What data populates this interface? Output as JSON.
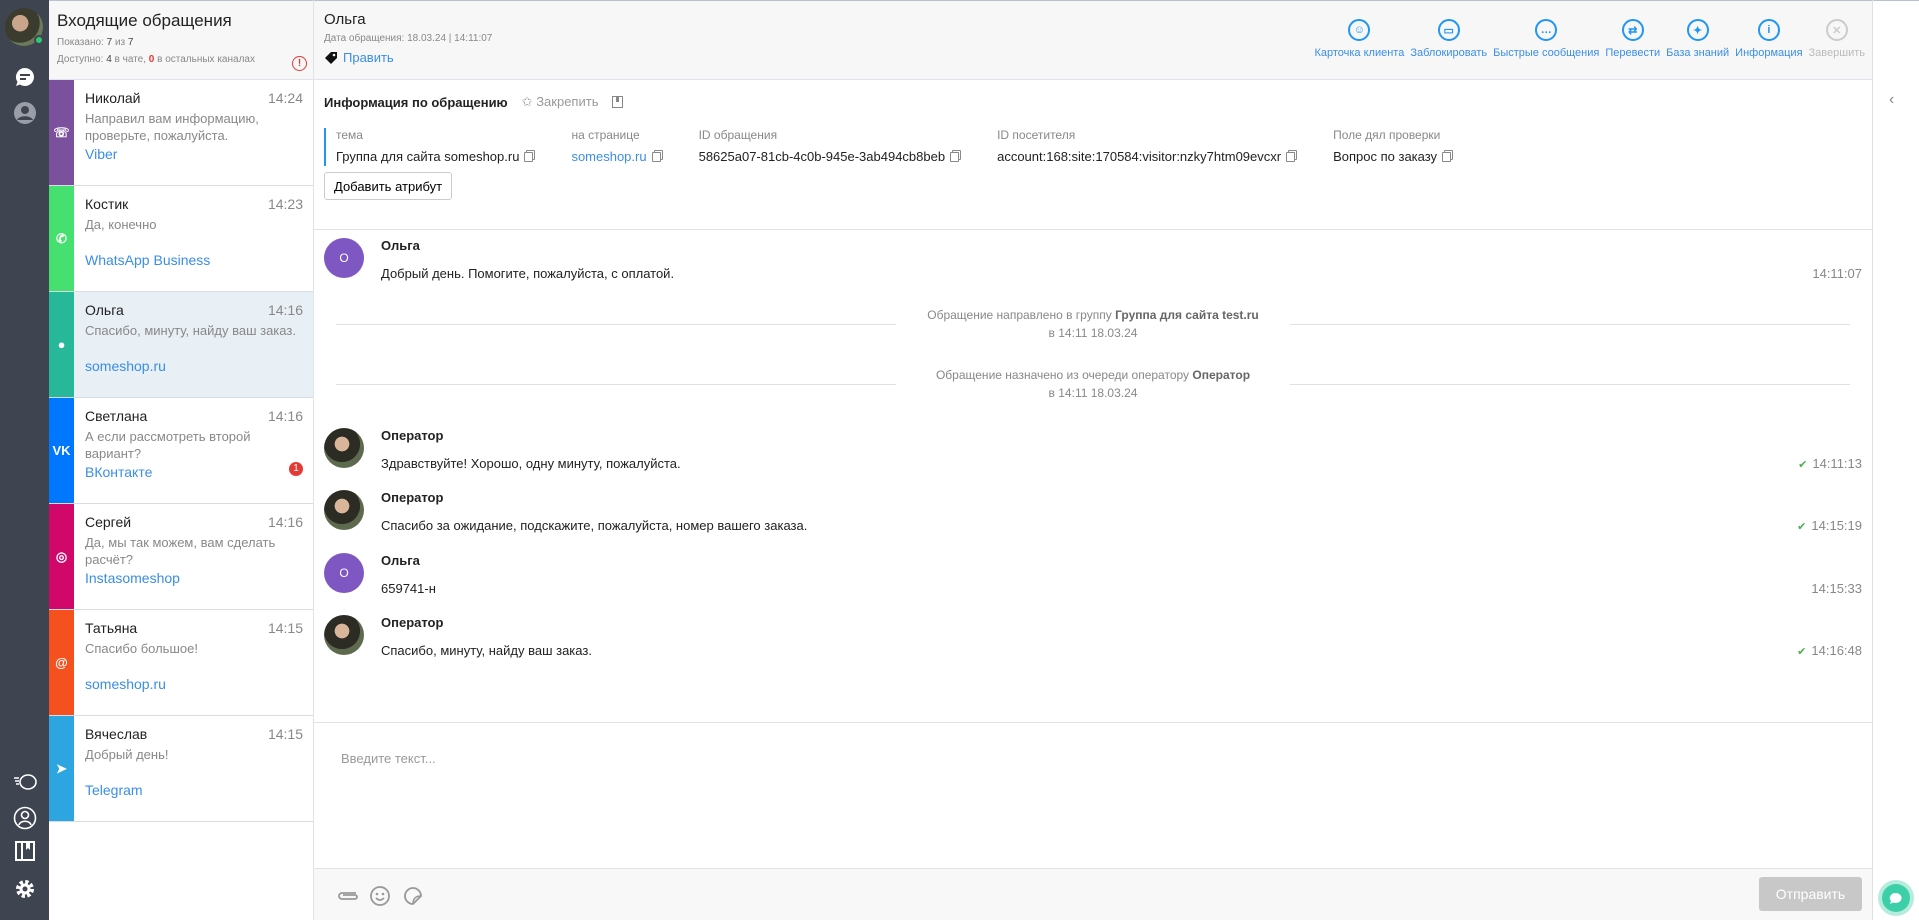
{
  "list": {
    "title": "Входящие обращения",
    "shown_label": "Показано:",
    "shown": "7",
    "of": "из",
    "total": "7",
    "available_label": "Доступно:",
    "in_chat": "4",
    "in_chat_label": "в чате,",
    "other": "0",
    "other_label": "в остальных каналах",
    "items": [
      {
        "name": "Николай",
        "time": "14:24",
        "preview": "Направил вам информацию, проверьте, пожалуйста.",
        "channel": "Viber",
        "color": "#7b519d",
        "icon": "viber-icon",
        "glyph": "☏"
      },
      {
        "name": "Костик",
        "time": "14:23",
        "preview": "Да, конечно",
        "channel": "WhatsApp Business",
        "color": "#45e06f",
        "icon": "whatsapp-icon",
        "glyph": "✆"
      },
      {
        "name": "Ольга",
        "time": "14:16",
        "preview": "Спасибо, минуту, найду ваш заказ.",
        "channel": "someshop.ru",
        "color": "#26b899",
        "icon": "chat-bubble-icon",
        "glyph": "●"
      },
      {
        "name": "Светлана",
        "time": "14:16",
        "preview": "А если рассмотреть второй вариант?",
        "channel": "ВКонтакте",
        "color": "#0077ff",
        "icon": "vk-icon",
        "glyph": "VK",
        "badge": "1"
      },
      {
        "name": "Сергей",
        "time": "14:16",
        "preview": "Да, мы так можем, вам сделать расчёт?",
        "channel": "Instasomeshop",
        "color": "#d10869",
        "icon": "instagram-icon",
        "glyph": "◎"
      },
      {
        "name": "Татьяна",
        "time": "14:15",
        "preview": "Спасибо большое!",
        "channel": "someshop.ru",
        "color": "#f4511e",
        "icon": "email-icon",
        "glyph": "@"
      },
      {
        "name": "Вячеслав",
        "time": "14:15",
        "preview": "Добрый день!",
        "channel": "Telegram",
        "color": "#2ca5e0",
        "icon": "telegram-icon",
        "glyph": "➤"
      }
    ]
  },
  "header": {
    "name": "Ольга",
    "date": "Дата обращения: 18.03.24 | 14:11:07",
    "edit": "Править",
    "actions": [
      {
        "label": "Карточка клиента",
        "glyph": "☺"
      },
      {
        "label": "Заблокировать",
        "glyph": "▭"
      },
      {
        "label": "Быстрые сообщения",
        "glyph": "…"
      },
      {
        "label": "Перевести",
        "glyph": "⇄"
      },
      {
        "label": "База знаний",
        "glyph": "✦"
      },
      {
        "label": "Информация",
        "glyph": "i"
      },
      {
        "label": "Завершить",
        "glyph": "✕"
      }
    ]
  },
  "info": {
    "title": "Информация по обращению",
    "pin": "Закрепить",
    "add": "Добавить атрибут",
    "attrs": [
      {
        "label": "тема",
        "value": "Группа для сайта someshop.ru"
      },
      {
        "label": "на странице",
        "value": "someshop.ru"
      },
      {
        "label": "ID обращения",
        "value": "58625a07-81cb-4c0b-945e-3ab494cb8beb"
      },
      {
        "label": "ID посетителя",
        "value": "account:168:site:170584:visitor:nzky7htm09evcxr"
      },
      {
        "label": "Поле дял проверки",
        "value": "Вопрос по заказу"
      }
    ]
  },
  "messages": [
    {
      "author": "Ольга",
      "initial": "О",
      "text": "Добрый день. Помогите, пожалуйста, с оплатой.",
      "time": "14:11:07"
    },
    {
      "author": "Оператор",
      "text": "Здравствуйте! Хорошо, одну минуту, пожалуйста.",
      "time": "14:11:13"
    },
    {
      "author": "Оператор",
      "text": "Спасибо за ожидание, подскажите, пожалуйста, номер вашего заказа.",
      "time": "14:15:19"
    },
    {
      "author": "Ольга",
      "initial": "О",
      "text": "659741-н",
      "time": "14:15:33"
    },
    {
      "author": "Оператор",
      "text": "Спасибо, минуту, найду ваш заказ.",
      "time": "14:16:48"
    }
  ],
  "events": [
    {
      "text": "Обращение направлено в группу",
      "bold": "Группа для сайта test.ru",
      "when": "в 14:11 18.03.24"
    },
    {
      "text": "Обращение назначено из очереди оператору",
      "bold": "Оператор",
      "when": "в 14:11 18.03.24"
    }
  ],
  "composer": {
    "placeholder": "Введите текст...",
    "send": "Отправить"
  }
}
